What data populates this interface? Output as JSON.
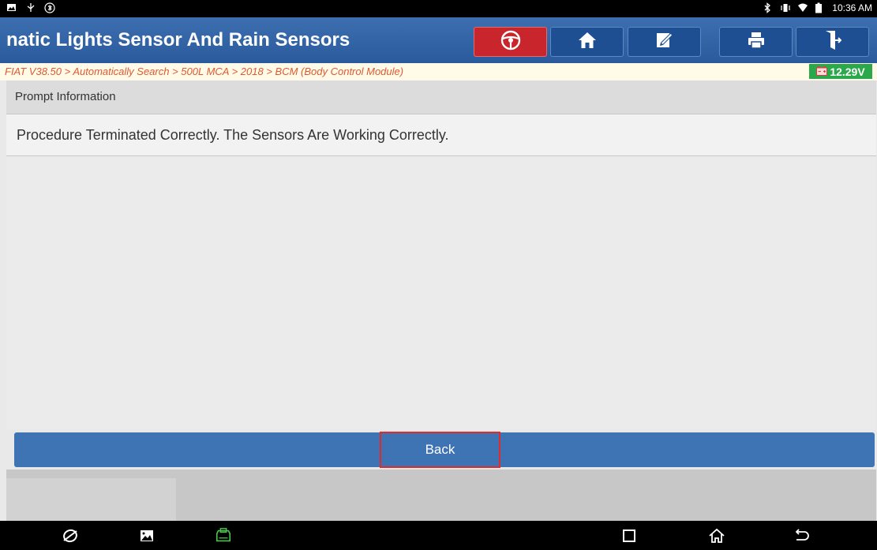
{
  "status_bar": {
    "time": "10:36 AM",
    "left_icons": [
      "image-notification-icon",
      "usb-icon",
      "bluetooth-settings-icon"
    ],
    "right_icons": [
      "bluetooth-icon",
      "vibrate-icon",
      "wifi-icon",
      "battery-icon"
    ]
  },
  "header": {
    "title": "natic Lights Sensor And Rain Sensors",
    "buttons": [
      {
        "name": "steering-wheel-icon",
        "color": "#c8262c"
      },
      {
        "name": "home-icon"
      },
      {
        "name": "edit-report-icon"
      },
      {
        "name": "print-icon"
      },
      {
        "name": "exit-icon"
      }
    ]
  },
  "breadcrumb": {
    "path": "FIAT V38.50 > Automatically Search > 500L MCA > 2018 > BCM (Body Control Module)",
    "voltage": "12.29V",
    "voltage_color": "#2aa84a"
  },
  "main": {
    "section_title": "Prompt Information",
    "message": "Procedure Terminated Correctly. The Sensors Are Working Correctly."
  },
  "actions": {
    "back_label": "Back"
  },
  "nav_bar": {
    "icons": [
      "browser-icon",
      "gallery-icon",
      "vci-icon",
      "recent-apps-icon",
      "home-nav-icon",
      "back-nav-icon"
    ]
  }
}
